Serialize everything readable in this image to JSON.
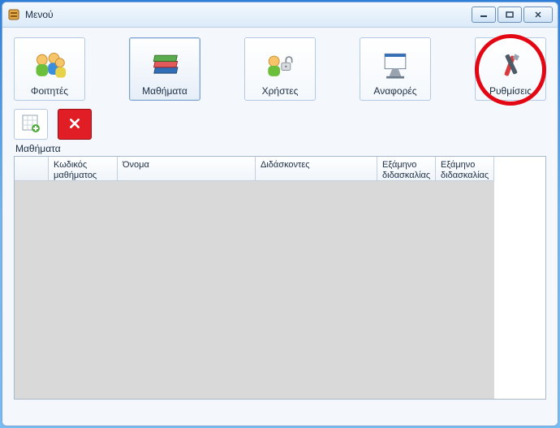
{
  "window": {
    "title": "Μενού"
  },
  "toolbar": {
    "students": {
      "label": "Φοιτητές"
    },
    "courses": {
      "label": "Μαθήματα"
    },
    "users": {
      "label": "Χρήστες"
    },
    "reports": {
      "label": "Αναφορές"
    },
    "settings": {
      "label": "Ρυθμίσεις"
    }
  },
  "section": {
    "label": "Μαθήματα"
  },
  "grid": {
    "columns": {
      "code": "Κωδικός μαθήματος",
      "name": "Όνομα",
      "teachers": "Διδάσκοντες",
      "semester1": "Εξάμηνο διδασκαλίας",
      "semester2": "Εξάμηνο διδασκαλίας"
    },
    "rows": []
  }
}
